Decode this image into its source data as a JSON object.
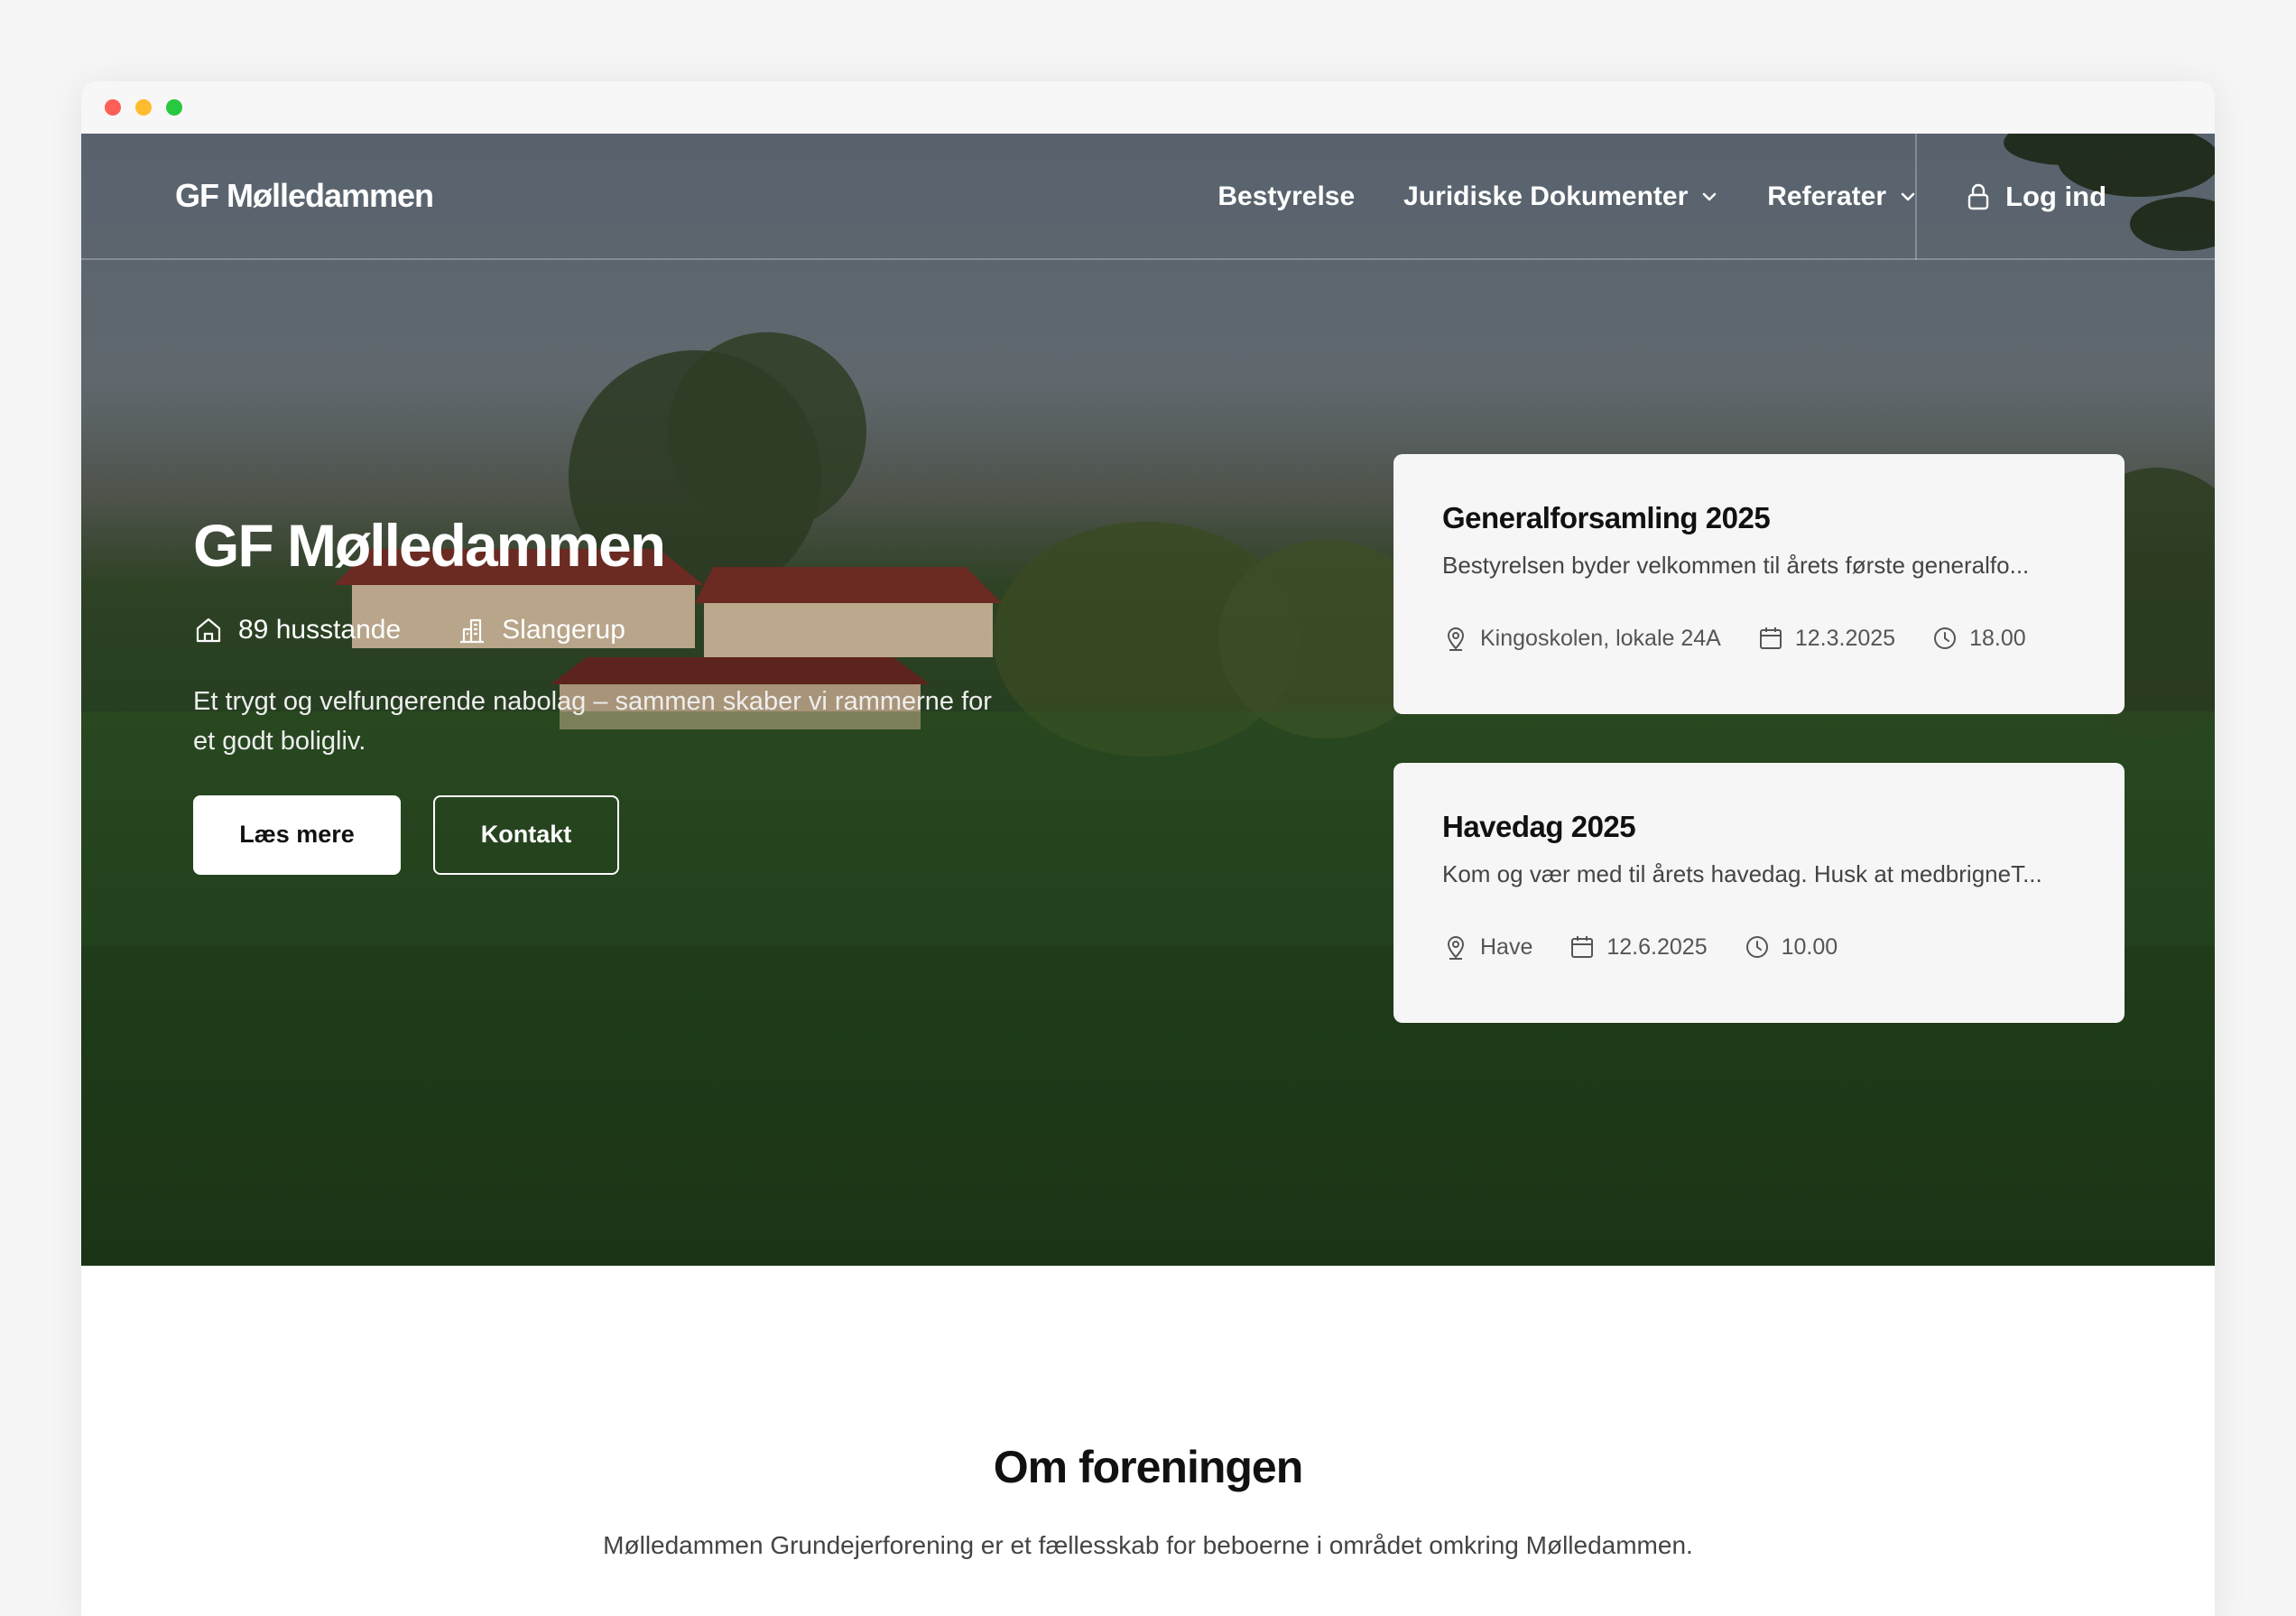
{
  "navbar": {
    "brand": "GF Mølledammen",
    "links": [
      {
        "label": "Bestyrelse"
      },
      {
        "label": "Juridiske Dokumenter"
      },
      {
        "label": "Referater"
      }
    ],
    "login_label": "Log ind"
  },
  "hero": {
    "title": "GF Mølledammen",
    "stats": [
      {
        "icon": "home-icon",
        "label": "89 husstande"
      },
      {
        "icon": "city-icon",
        "label": "Slangerup"
      }
    ],
    "tagline": "Et trygt og velfungerende nabolag – sammen skaber vi rammerne for et godt boligliv.",
    "primary_button": "Læs mere",
    "secondary_button": "Kontakt"
  },
  "events": [
    {
      "title": "Generalforsamling 2025",
      "description": "Bestyrelsen byder velkommen til årets første generalfo...",
      "location": "Kingoskolen, lokale 24A",
      "date": "12.3.2025",
      "time": "18.00"
    },
    {
      "title": "Havedag 2025",
      "description": "Kom og vær med til årets havedag. Husk at medbrigneT...",
      "location": "Have",
      "date": "12.6.2025",
      "time": "10.00"
    }
  ],
  "about": {
    "heading": "Om foreningen",
    "text": "Mølledammen Grundejerforening er et fællesskab for beboerne i området omkring Mølledammen."
  }
}
